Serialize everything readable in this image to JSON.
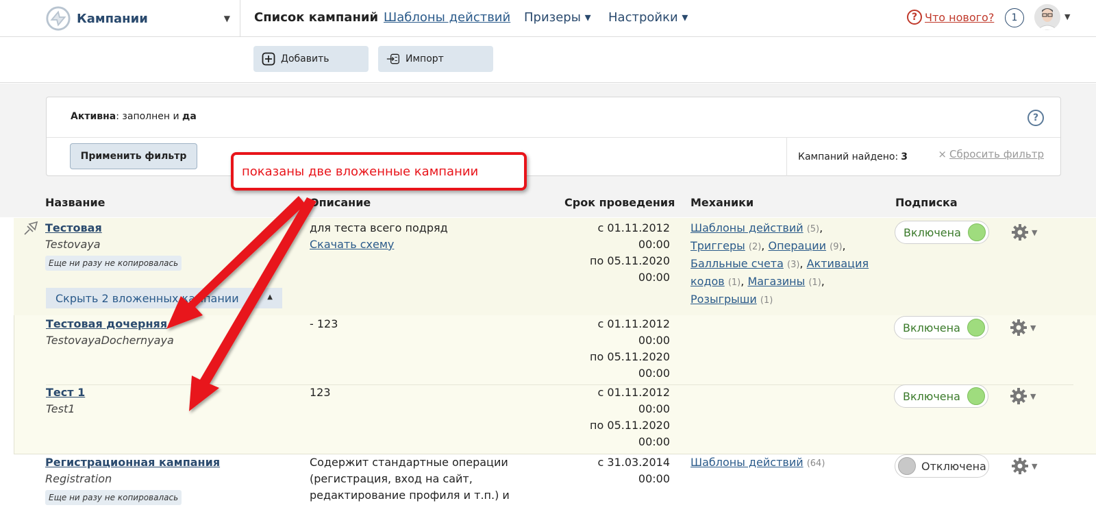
{
  "nav": {
    "brand": "Кампании",
    "items": [
      {
        "label": "Список кампаний",
        "active": true
      },
      {
        "label": "Шаблоны действий",
        "link": true
      },
      {
        "label": "Призеры ▾"
      },
      {
        "label": "Настройки ▾"
      }
    ],
    "whats_new": "Что нового?",
    "notify_count": "1"
  },
  "toolbar": {
    "add": "Добавить",
    "import": "Импорт"
  },
  "filter": {
    "field": "Активна",
    "condition": ": заполнен и ",
    "value": "да",
    "apply": "Применить фильтр",
    "found_label": "Кампаний найдено:",
    "found_count": "3",
    "reset": "Сбросить фильтр"
  },
  "table": {
    "headers": [
      "Название",
      "Описание",
      "Срок проведения",
      "Механики",
      "Подписка"
    ],
    "hide_children": "Скрыть 2 вложенных кампании",
    "rows": [
      {
        "name": "Тестовая",
        "code": "Testovaya",
        "copied": "Еще ни разу не копировалась",
        "desc": "для теста всего подряд",
        "desc_link": "Скачать схему",
        "date1": "с 01.11.2012 00:00",
        "date2": "по 05.11.2020",
        "date3": "00:00",
        "mechanics": [
          {
            "label": "Шаблоны действий",
            "n": "(5)",
            "sep": ","
          },
          {
            "label": "Триггеры",
            "n": "(2)",
            "sep": ","
          },
          {
            "label": "Операции",
            "n": "(9)",
            "sep": ","
          },
          {
            "label": "Балльные счета",
            "n": "(3)",
            "sep": ","
          },
          {
            "label": "Активация кодов",
            "n": "(1)",
            "sep": ","
          },
          {
            "label": "Магазины",
            "n": "(1)",
            "sep": ","
          },
          {
            "label": "Розыгрыши",
            "n": "(1)",
            "sep": ""
          }
        ],
        "subscription": "Включена"
      },
      {
        "name": "Тестовая дочерняя",
        "code": "TestovayaDochernyaya",
        "desc": "- 123",
        "date1": "с 01.11.2012 00:00",
        "date2": "по 05.11.2020",
        "date3": "00:00",
        "subscription": "Включена"
      },
      {
        "name": "Тест 1",
        "code": "Test1",
        "desc": "123",
        "date1": "с 01.11.2012 00:00",
        "date2": "по 05.11.2020",
        "date3": "00:00",
        "subscription": "Включена"
      },
      {
        "name": "Регистрационная кампания",
        "code": "Registration",
        "copied": "Еще ни разу не копировалась",
        "desc1": "Содержит стандартные операции",
        "desc2": "(регистрация, вход на сайт,",
        "desc3": "редактирование профиля и т.п.) и",
        "date1": "с 31.03.2014 00:00",
        "mechanics": [
          {
            "label": "Шаблоны действий",
            "n": "(64)",
            "sep": ""
          }
        ],
        "subscription": "Отключена"
      }
    ]
  },
  "annotation": "показаны две вложенные кампании",
  "colors": {
    "accent": "#2a4a6e",
    "annotation": "#e8141a",
    "toggle_on": "#9fdc7e",
    "row_highlight": "#f8f8e9"
  }
}
